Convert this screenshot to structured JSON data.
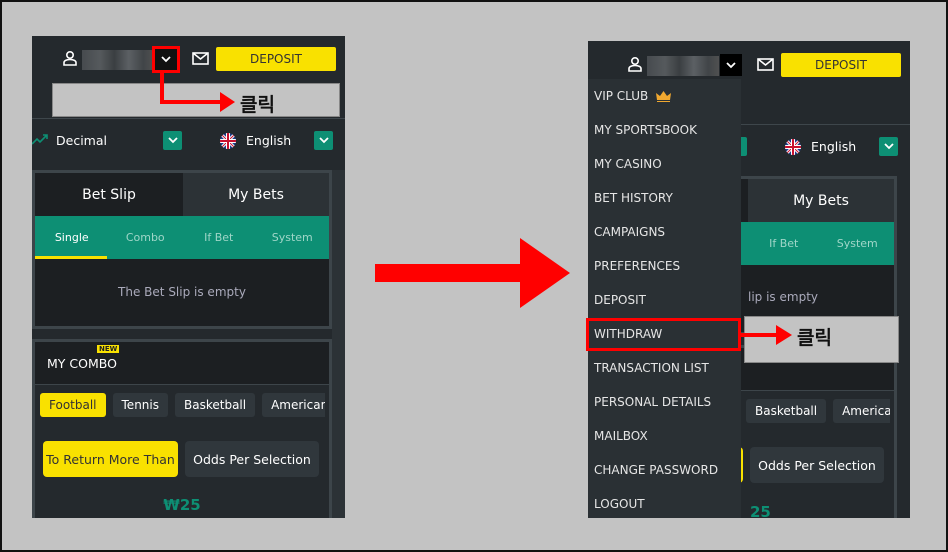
{
  "header": {
    "deposit_label": "DEPOSIT"
  },
  "odds": {
    "format": "Decimal",
    "language": "English"
  },
  "betslip": {
    "tabs": [
      "Bet Slip",
      "My Bets"
    ],
    "subtabs": [
      "Single",
      "Combo",
      "If Bet",
      "System"
    ],
    "active_subtab": "Single",
    "empty_text": "The Bet Slip is empty",
    "empty_text_partial": "lip is empty"
  },
  "my_combo": {
    "title": "MY COMBO",
    "badge": "NEW",
    "sports": [
      "Football",
      "Tennis",
      "Basketball",
      "American Foo"
    ],
    "active_sport": "Football",
    "buttons": [
      "To Return More Than",
      "Odds Per Selection"
    ],
    "amount": "₩25",
    "amount_partial": "25"
  },
  "menu": {
    "items": [
      "VIP CLUB",
      "MY SPORTSBOOK",
      "MY CASINO",
      "BET HISTORY",
      "CAMPAIGNS",
      "PREFERENCES",
      "DEPOSIT",
      "WITHDRAW",
      "TRANSACTION LIST",
      "PERSONAL DETAILS",
      "MAILBOX",
      "CHANGE PASSWORD",
      "LOGOUT"
    ],
    "highlighted": "WITHDRAW"
  },
  "annotation": {
    "click_label": "클릭"
  },
  "colors": {
    "accent_yellow": "#f9e100",
    "accent_green": "#0d8f74",
    "annotation_red": "#ff0000",
    "background": "#24292d"
  }
}
